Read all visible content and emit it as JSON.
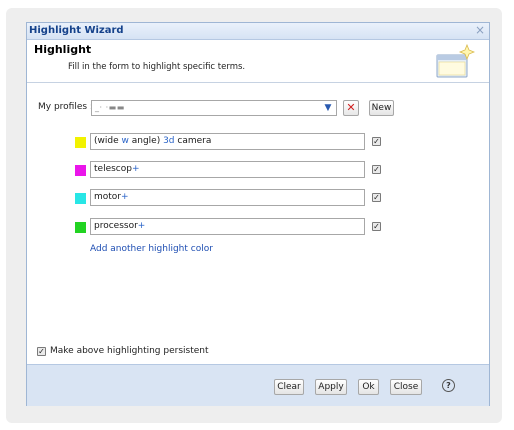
{
  "window": {
    "title": "Highlight Wizard",
    "close_glyph": "×"
  },
  "header": {
    "title": "Highlight",
    "subtitle": "Fill in the form to highlight specific terms.",
    "icon": "wizard-window-icon"
  },
  "profiles": {
    "label": "My profiles :",
    "selected_value": "_·  ·▬▬",
    "delete_glyph": "✕",
    "new_label": "New"
  },
  "highlights": [
    {
      "color": "#f2f200",
      "term_parts": [
        {
          "text": "(wide ",
          "blue": false
        },
        {
          "text": "w",
          "blue": true
        },
        {
          "text": " angle) ",
          "blue": false
        },
        {
          "text": "3d",
          "blue": true
        },
        {
          "text": " camera",
          "blue": false
        }
      ],
      "checked": true
    },
    {
      "color": "#ea16ea",
      "term_parts": [
        {
          "text": "telescop",
          "blue": false
        },
        {
          "text": "+",
          "blue": true
        }
      ],
      "checked": true
    },
    {
      "color": "#28e6e6",
      "term_parts": [
        {
          "text": "motor",
          "blue": false
        },
        {
          "text": "+",
          "blue": true
        }
      ],
      "checked": true
    },
    {
      "color": "#22d322",
      "term_parts": [
        {
          "text": "processor",
          "blue": false
        },
        {
          "text": "+",
          "blue": true
        }
      ],
      "checked": true
    }
  ],
  "add_color_label": "Add another highlight color",
  "persistent": {
    "label": "Make above highlighting persistent",
    "checked": true
  },
  "footer": {
    "clear": "Clear",
    "apply": "Apply",
    "ok": "Ok",
    "close": "Close",
    "help_glyph": "?"
  },
  "colors": {
    "title_text": "#15428b",
    "footer_bg": "#d9e4f3",
    "link": "#1f4fb3"
  }
}
